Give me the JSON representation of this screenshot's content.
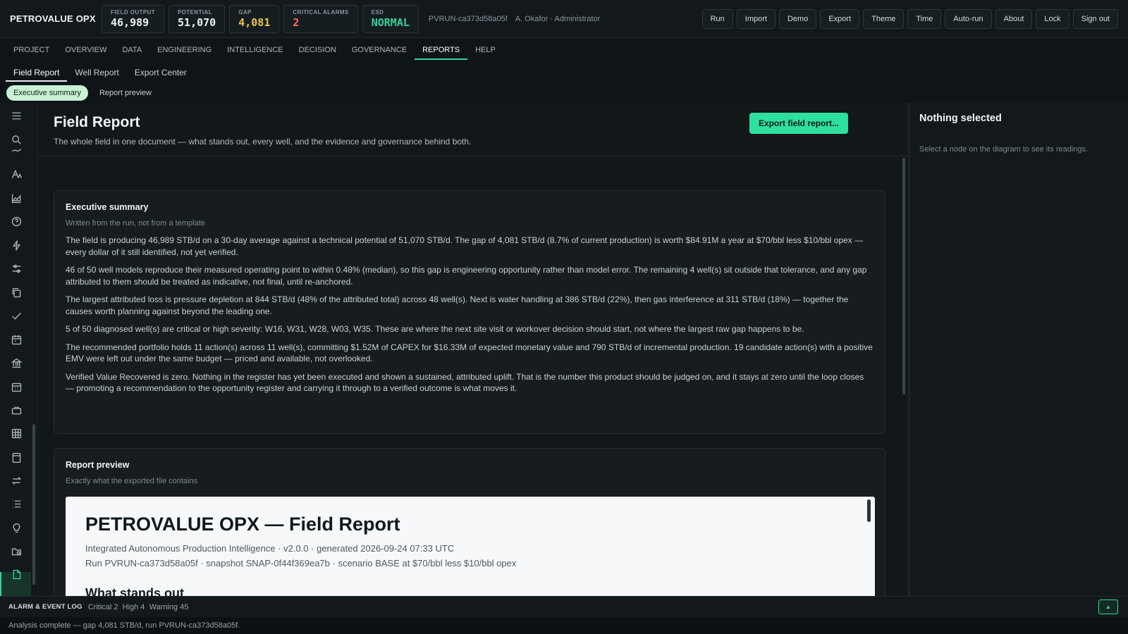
{
  "app": {
    "brand": "PETROVALUE OPX",
    "run_id": "PVRUN-ca373d58a05f",
    "user": "A. Okafor · Administrator"
  },
  "kpis": [
    {
      "label": "FIELD OUTPUT",
      "value": "46,989",
      "tone": "normal"
    },
    {
      "label": "POTENTIAL",
      "value": "51,070",
      "tone": "normal"
    },
    {
      "label": "GAP",
      "value": "4,081",
      "tone": "amber"
    },
    {
      "label": "CRITICAL ALARMS",
      "value": "2",
      "tone": "red"
    },
    {
      "label": "ESD",
      "value": "NORMAL",
      "tone": "green"
    }
  ],
  "actions": [
    "Run",
    "Import",
    "Demo",
    "Export",
    "Theme",
    "Time",
    "Auto-run",
    "About",
    "Lock",
    "Sign out"
  ],
  "main_nav": {
    "items": [
      "PROJECT",
      "OVERVIEW",
      "DATA",
      "ENGINEERING",
      "INTELLIGENCE",
      "DECISION",
      "GOVERNANCE",
      "REPORTS",
      "HELP"
    ],
    "active": "REPORTS"
  },
  "sub_nav": {
    "items": [
      "Field Report",
      "Well Report",
      "Export Center"
    ],
    "active": "Field Report"
  },
  "section_pills": {
    "items": [
      "Executive summary",
      "Report preview"
    ],
    "active": "Executive summary"
  },
  "rail_icons": [
    "menu-icon",
    "search-icon",
    "curve-icon",
    "text-icon",
    "area-chart-icon",
    "help-icon",
    "bolt-icon",
    "sliders-icon",
    "copy-icon",
    "check-icon",
    "calendar-icon",
    "bank-icon",
    "calendar-grid-icon",
    "briefcase-icon",
    "table-icon",
    "clipboard-icon",
    "swap-icon",
    "list-icon",
    "bulb-icon",
    "folder-settings-icon",
    "document-icon"
  ],
  "page": {
    "title": "Field Report",
    "subtitle": "The whole field in one document — what stands out, every well, and the evidence and governance behind both.",
    "export_label": "Export field report..."
  },
  "executive_summary": {
    "title": "Executive summary",
    "hint": "Written from the run, not from a template",
    "paragraphs": [
      "The field is producing 46,989 STB/d on a 30-day average against a technical potential of 51,070 STB/d. The gap of 4,081 STB/d (8.7% of current production) is worth $84.91M a year at $70/bbl less $10/bbl opex — every dollar of it still identified, not yet verified.",
      "46 of 50 well models reproduce their measured operating point to within 0.48% (median), so this gap is engineering opportunity rather than model error. The remaining 4 well(s) sit outside that tolerance, and any gap attributed to them should be treated as indicative, not final, until re-anchored.",
      "The largest attributed loss is pressure depletion at 844 STB/d (48% of the attributed total) across 48 well(s). Next is water handling at 386 STB/d (22%), then gas interference at 311 STB/d (18%) — together the causes worth planning against beyond the leading one.",
      "5 of 50 diagnosed well(s) are critical or high severity: W16, W31, W28, W03, W35. These are where the next site visit or workover decision should start, not where the largest raw gap happens to be.",
      "The recommended portfolio holds 11 action(s) across 11 well(s), committing $1.52M of CAPEX for $16.33M of expected monetary value and 790 STB/d of incremental production. 19 candidate action(s) with a positive EMV were left out under the same budget — priced and available, not overlooked.",
      "Verified Value Recovered is zero. Nothing in the register has yet been executed and shown a sustained, attributed uplift. That is the number this product should be judged on, and it stays at zero until the loop closes — promoting a recommendation to the opportunity register and carrying it through to a verified outcome is what moves it."
    ]
  },
  "report_preview": {
    "title": "Report preview",
    "hint": "Exactly what the exported file contains",
    "doc_title": "PETROVALUE OPX — Field Report",
    "meta_line1": "Integrated Autonomous Production Intelligence · v2.0.0 · generated 2026-09-24 07:33 UTC",
    "meta_line2": "Run PVRUN-ca373d58a05f · snapshot SNAP-0f44f369ea7b · scenario BASE at $70/bbl less $10/bbl opex",
    "section_heading": "What stands out"
  },
  "right_panel": {
    "title": "Nothing selected",
    "description": "Select a node on the diagram to see its readings."
  },
  "alarm_log": {
    "title": "ALARM & EVENT LOG",
    "summary": "Critical 2  High 4  Warning 45",
    "toggle": "▲"
  },
  "status": "Analysis complete — gap 4,081 STB/d, run PVRUN-ca373d58a05f.",
  "colors": {
    "accent": "#2ee0a0",
    "amber": "#f0c24b",
    "critical": "#ff6b5e"
  }
}
